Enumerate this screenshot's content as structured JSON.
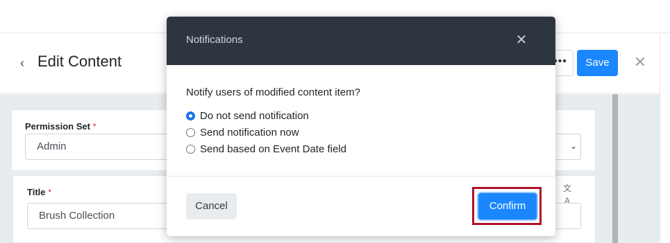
{
  "page": {
    "title": "Edit Content",
    "back_icon": "chevron-left-icon",
    "back_glyph": "‹",
    "more_glyph": "•••",
    "save_label": "Save",
    "close_glyph": "✕"
  },
  "form": {
    "permission_set": {
      "label": "Permission Set",
      "required_mark": "*",
      "value": "Admin",
      "chevron_glyph": "⌄"
    },
    "title_field": {
      "label": "Title",
      "required_mark": "*",
      "value": "Brush Collection",
      "translate_glyph": "文A"
    }
  },
  "modal": {
    "title": "Notifications",
    "close_glyph": "✕",
    "question": "Notify users of modified content item?",
    "options": [
      {
        "label": "Do not send notification",
        "checked": true
      },
      {
        "label": "Send notification now",
        "checked": false
      },
      {
        "label": "Send based on Event Date field",
        "checked": false
      }
    ],
    "cancel_label": "Cancel",
    "confirm_label": "Confirm"
  },
  "colors": {
    "accent": "#1b87ff",
    "modal_header": "#2d3640",
    "highlight_box": "#b0102a",
    "required": "#d9302f"
  }
}
